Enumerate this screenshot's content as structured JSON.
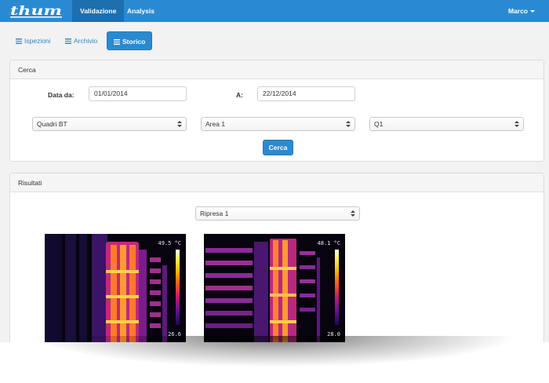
{
  "navbar": {
    "brand": "thum",
    "items": [
      {
        "label": "Validazione",
        "active": true
      },
      {
        "label": "Analysis",
        "active": false
      }
    ],
    "user": "Marco"
  },
  "pills": [
    {
      "label": "Ispezioni",
      "icon": "list-icon",
      "active": false
    },
    {
      "label": "Archivio",
      "icon": "list-icon",
      "active": false
    },
    {
      "label": "Storico",
      "icon": "list-icon",
      "active": true
    }
  ],
  "search": {
    "title": "Cerca",
    "date_from_label": "Data da:",
    "date_from_value": "01/01/2014",
    "date_to_label": "A:",
    "date_to_value": "22/12/2014",
    "category_select": "Quadri BT",
    "area_select": "Area 1",
    "panel_select": "Q1",
    "submit_label": "Cerca"
  },
  "results": {
    "title": "Risultati",
    "shot_select": "Ripresa 1",
    "images": [
      {
        "max_temp": "49.5 °C",
        "min_temp": "26.6"
      },
      {
        "max_temp": "48.1 °C",
        "min_temp": "28.0"
      }
    ]
  },
  "colors": {
    "accent": "#2a8ad1",
    "navbar_active": "#1e6fae",
    "panel_header": "#f5f5f5",
    "background": "#f2f2f2"
  }
}
